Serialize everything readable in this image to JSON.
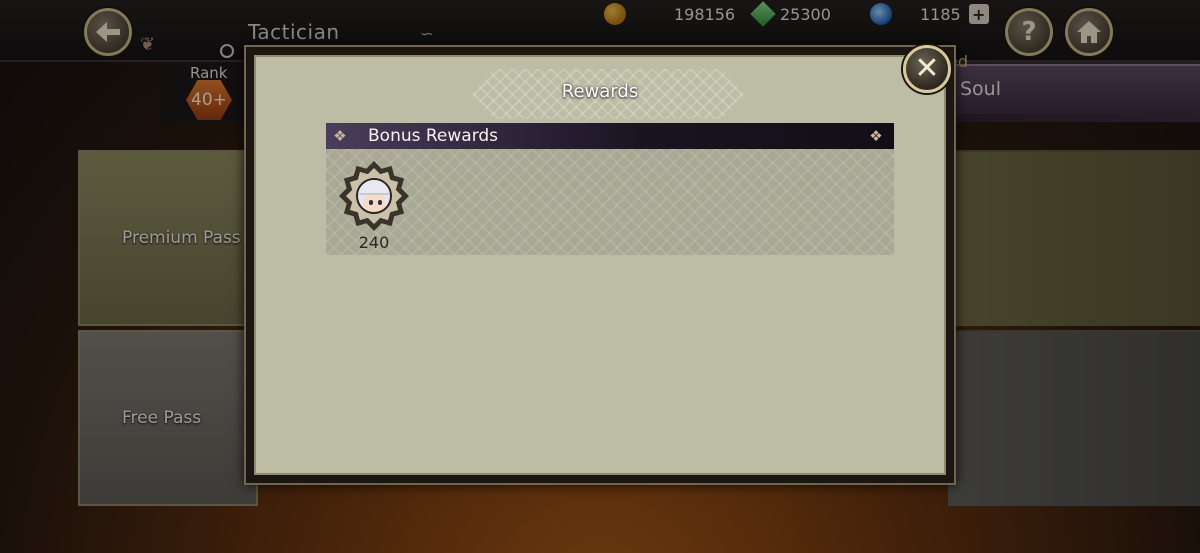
{
  "header": {
    "screen_title": "Tactician",
    "rank_label": "Rank",
    "rank_value": "40+",
    "help_label": "?",
    "currencies": [
      {
        "name": "gold",
        "value": "198156"
      },
      {
        "name": "gem",
        "value": "25300"
      },
      {
        "name": "orb",
        "value": "1185"
      }
    ]
  },
  "background": {
    "tab_partial_top": "ed",
    "tab_partial": "Soul",
    "premium_pass_label": "Premium Pass",
    "free_pass_label": "Free Pass"
  },
  "modal": {
    "title": "Rewards",
    "close_label": "✕",
    "section_title": "Bonus Rewards",
    "rewards": [
      {
        "icon": "character-portrait-icon",
        "quantity": "240"
      }
    ]
  },
  "colors": {
    "panel_bg": "#bdbda6",
    "section_header": "#1a1422",
    "accent_gold": "#d8c89a"
  }
}
